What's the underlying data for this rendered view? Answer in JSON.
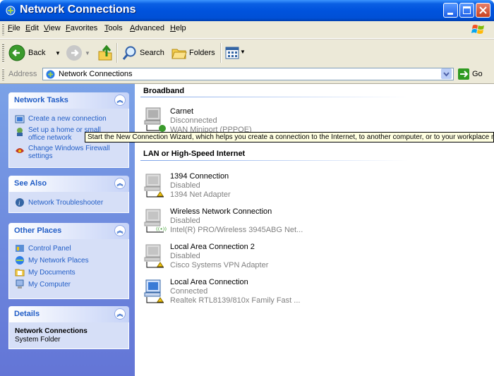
{
  "window": {
    "title": "Network Connections"
  },
  "menu": [
    "File",
    "Edit",
    "View",
    "Favorites",
    "Tools",
    "Advanced",
    "Help"
  ],
  "toolbar": {
    "back": "Back",
    "search": "Search",
    "folders": "Folders"
  },
  "address": {
    "label": "Address",
    "value": "Network Connections",
    "go": "Go"
  },
  "tasks": {
    "network_tasks": {
      "title": "Network Tasks",
      "items": [
        {
          "label": "Create a new connection"
        },
        {
          "label1": "Set up a home or small",
          "label2": "office network"
        },
        {
          "label1": "Change Windows Firewall",
          "label2": "settings"
        }
      ]
    },
    "see_also": {
      "title": "See Also",
      "items": [
        "Network Troubleshooter"
      ]
    },
    "other_places": {
      "title": "Other Places",
      "items": [
        "Control Panel",
        "My Network Places",
        "My Documents",
        "My Computer"
      ]
    },
    "details": {
      "title": "Details",
      "name": "Network Connections",
      "type": "System Folder"
    }
  },
  "groups": [
    {
      "title": "Broadband",
      "connections": [
        {
          "name": "Carnet",
          "status": "Disconnected",
          "device": "WAN Miniport (PPPOE)"
        }
      ]
    },
    {
      "title": "LAN or High-Speed Internet",
      "connections": [
        {
          "name": "1394 Connection",
          "status": "Disabled",
          "device": "1394 Net Adapter"
        },
        {
          "name": "Wireless Network Connection",
          "status": "Disabled",
          "device": "Intel(R) PRO/Wireless 3945ABG Net..."
        },
        {
          "name": "Local Area Connection 2",
          "status": "Disabled",
          "device": "Cisco Systems VPN Adapter"
        },
        {
          "name": "Local Area Connection",
          "status": "Connected",
          "device": "Realtek RTL8139/810x Family Fast ..."
        }
      ]
    }
  ],
  "tooltip": "Start the New Connection Wizard, which helps you create a connection to the Internet, to another computer, or to your workplace network.",
  "colors": {
    "titlebar": "#0053dd",
    "taskpane": "#7ba2e7",
    "link": "#215dc6",
    "tooltip_bg": "#ffffe1"
  }
}
